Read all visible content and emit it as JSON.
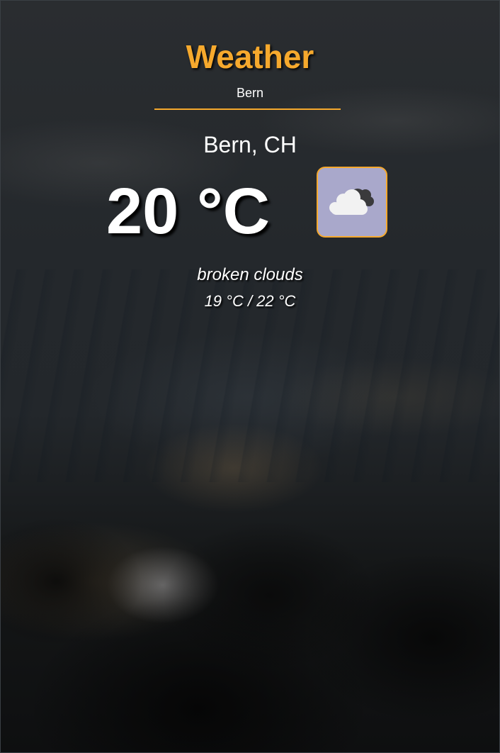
{
  "header": {
    "title": "Weather",
    "subtitle": "Bern"
  },
  "weather": {
    "location": "Bern, CH",
    "temperature": "20 °C",
    "description": "broken clouds",
    "range": "19 °C / 22 °C",
    "icon": "broken-clouds-icon"
  },
  "colors": {
    "accent": "#f6a92d",
    "icon_background": "#a9a8cb",
    "text": "#ffffff"
  }
}
